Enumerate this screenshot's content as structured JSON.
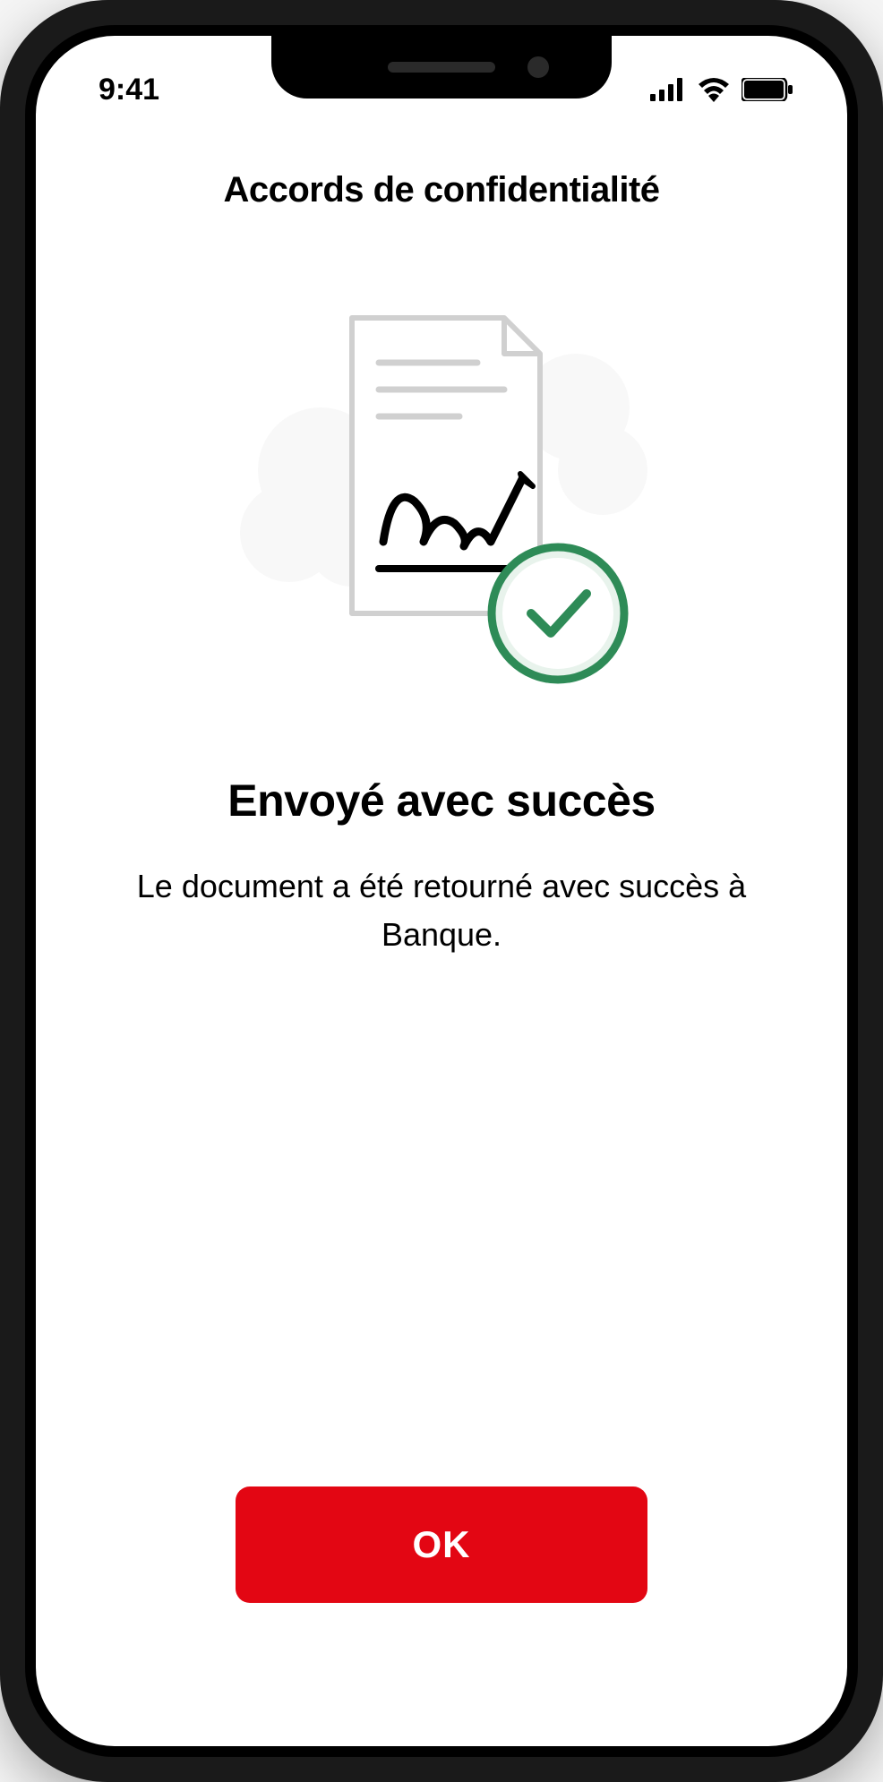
{
  "status_bar": {
    "time": "9:41"
  },
  "header": {
    "title": "Accords de confidentialité"
  },
  "content": {
    "success_heading": "Envoyé avec succès",
    "success_message": "Le document a été retourné avec succès à Banque."
  },
  "footer": {
    "ok_button_label": "OK"
  },
  "colors": {
    "primary_red": "#e30613",
    "success_green": "#2e8b57"
  }
}
